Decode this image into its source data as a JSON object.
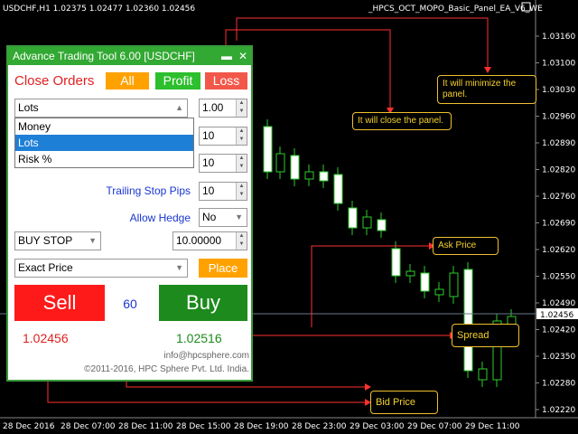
{
  "chart": {
    "symbol_info": "USDCHF,H1  1.02375 1.02477 1.02360 1.02456",
    "ea_name": "_HPCS_OCT_MOPO_Basic_Panel_EA_V6_WE",
    "current_price": "1.02456",
    "price_levels": [
      "1.03160",
      "1.03100",
      "1.03030",
      "1.02960",
      "1.02890",
      "1.02820",
      "1.02760",
      "1.02690",
      "1.02620",
      "1.02550",
      "1.02490",
      "1.02420",
      "1.02350",
      "1.02280",
      "1.02220"
    ],
    "time_labels": [
      "28 Dec 2016",
      "28 Dec 07:00",
      "28 Dec 11:00",
      "28 Dec 15:00",
      "28 Dec 19:00",
      "28 Dec 23:00",
      "29 Dec 03:00",
      "29 Dec 07:00",
      "29 Dec 11:00"
    ]
  },
  "panel": {
    "title": "Advance Trading Tool  6.00 [USDCHF]",
    "minimize_icon": "minimize-icon",
    "close_icon": "close-icon",
    "close_orders_label": "Close Orders",
    "all_button": "All",
    "profit_button": "Profit",
    "loss_button": "Loss",
    "lot_type_selected": "Lots",
    "lot_type_options": [
      "Money",
      "Lots",
      "Risk %"
    ],
    "lots_value": "1.00",
    "field2_value": "10",
    "field3_value": "10",
    "trailing_stop_label": "Trailing Stop Pips",
    "trailing_stop_value": "10",
    "allow_hedge_label": "Allow Hedge",
    "allow_hedge_value": "No",
    "order_type": "BUY STOP",
    "order_price": "10.00000",
    "price_mode": "Exact Price",
    "place_button": "Place",
    "sell_button": "Sell",
    "buy_button": "Buy",
    "spread_value": "60",
    "bid_price": "1.02456",
    "ask_price": "1.02516",
    "email": "info@hpcsphere.com",
    "copyright": "©2011-2016, HPC Sphere Pvt. Ltd. India."
  },
  "annotations": {
    "minimize_note": "It will minimize the panel.",
    "close_note": "It will close the panel.",
    "ask_note": "Ask Price",
    "spread_note": "Spread",
    "bid_note": "Bid Price"
  },
  "colors": {
    "panel_green": "#32a932",
    "sell_red": "#ff1a1a",
    "buy_green": "#1c8a1c",
    "annotation_yellow": "#f5d22c",
    "annotation_line": "#ff3030"
  }
}
